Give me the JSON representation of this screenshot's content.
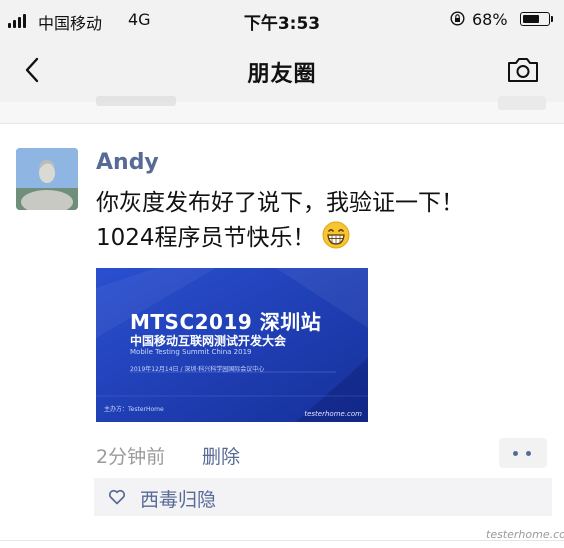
{
  "status_bar": {
    "carrier": "中国移动",
    "network": "4G",
    "time": "下午3:53",
    "battery_percent": "68%",
    "battery_level": 0.68
  },
  "nav": {
    "title": "朋友圈",
    "icons": {
      "back": "chevron-left-icon",
      "camera": "camera-icon"
    }
  },
  "post": {
    "author": "Andy",
    "text_line1": "你灰度发布好了说下，我验证一下！",
    "text_line2": "1024程序员节快乐！",
    "emoji": "grinning-face-icon",
    "time": "2分钟前",
    "delete_label": "删除",
    "image": {
      "title": "MTSC2019  深圳站",
      "subtitle": "中国移动互联网测试开发大会",
      "english": "Mobile Testing Summit China 2019",
      "date_line": "2019年12月14日  /  深圳·科兴科学园国际会议中心",
      "host": "主办方：TesterHome",
      "mark": "testerhome.com"
    },
    "likes": {
      "icon": "heart-outline-icon",
      "names": "西毒归隐"
    }
  },
  "watermark": "testerhome.com",
  "colors": {
    "link": "#576b95",
    "bar_bg": "#f2f2f2",
    "image_blue": "#1f3fb2"
  }
}
